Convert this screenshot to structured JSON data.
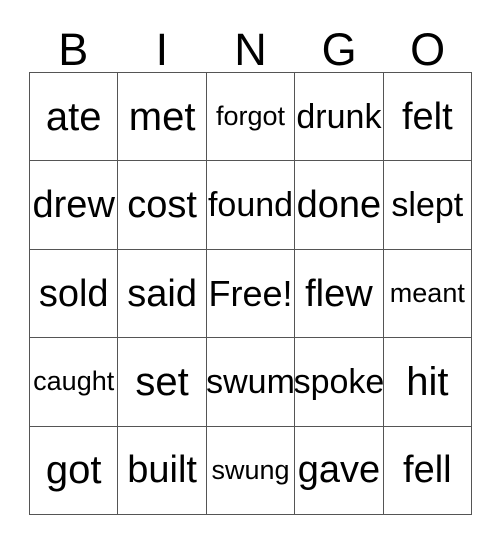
{
  "card": {
    "title": "BINGO",
    "header_letters": [
      "B",
      "I",
      "N",
      "G",
      "O"
    ],
    "free_space_label": "Free!",
    "colors": {
      "text": "#000000",
      "grid_line": "#555555",
      "background": "#ffffff"
    },
    "rows": [
      [
        {
          "label": "ate",
          "length": 3,
          "free": false
        },
        {
          "label": "met",
          "length": 3,
          "free": false
        },
        {
          "label": "forgot",
          "length": 6,
          "free": false
        },
        {
          "label": "drunk",
          "length": 5,
          "free": false
        },
        {
          "label": "felt",
          "length": 4,
          "free": false
        }
      ],
      [
        {
          "label": "drew",
          "length": 4,
          "free": false
        },
        {
          "label": "cost",
          "length": 4,
          "free": false
        },
        {
          "label": "found",
          "length": 5,
          "free": false
        },
        {
          "label": "done",
          "length": 4,
          "free": false
        },
        {
          "label": "slept",
          "length": 5,
          "free": false
        }
      ],
      [
        {
          "label": "sold",
          "length": 4,
          "free": false
        },
        {
          "label": "said",
          "length": 4,
          "free": false
        },
        {
          "label": "Free!",
          "length": 5,
          "free": true
        },
        {
          "label": "flew",
          "length": 4,
          "free": false
        },
        {
          "label": "meant",
          "length": 6,
          "free": false
        }
      ],
      [
        {
          "label": "caught",
          "length": 6,
          "free": false
        },
        {
          "label": "set",
          "length": 3,
          "free": false
        },
        {
          "label": "swum",
          "length": 5,
          "free": false
        },
        {
          "label": "spoke",
          "length": 5,
          "free": false
        },
        {
          "label": "hit",
          "length": 3,
          "free": false
        }
      ],
      [
        {
          "label": "got",
          "length": 3,
          "free": false
        },
        {
          "label": "built",
          "length": 4,
          "free": false
        },
        {
          "label": "swung",
          "length": 6,
          "free": false
        },
        {
          "label": "gave",
          "length": 4,
          "free": false
        },
        {
          "label": "fell",
          "length": 4,
          "free": false
        }
      ]
    ]
  }
}
